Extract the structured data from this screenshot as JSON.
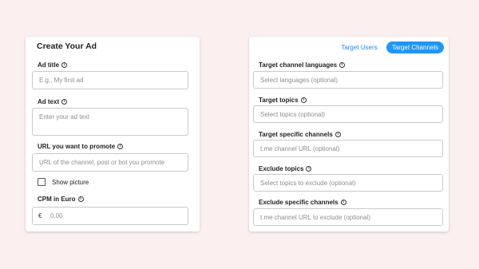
{
  "left": {
    "title": "Create Your Ad",
    "ad_title": {
      "label": "Ad title",
      "placeholder": "E.g., My first ad"
    },
    "ad_text": {
      "label": "Ad text",
      "placeholder": "Enter your ad text"
    },
    "promote_url": {
      "label": "URL you want to promote",
      "placeholder": "URL of the channel, post or bot you promote"
    },
    "show_picture": {
      "label": "Show picture",
      "checked": false
    },
    "cpm": {
      "label": "CPM in Euro",
      "currency": "€",
      "placeholder": "0.00"
    }
  },
  "right": {
    "tabs": [
      {
        "label": "Target Users",
        "active": false
      },
      {
        "label": "Target Channels",
        "active": true
      }
    ],
    "languages": {
      "label": "Target channel languages",
      "placeholder": "Select languages (optional)"
    },
    "topics": {
      "label": "Target topics",
      "placeholder": "Select topics (optional)"
    },
    "channels": {
      "label": "Target specific channels",
      "placeholder": "t.me channel URL (optional)"
    },
    "exclude_topics": {
      "label": "Exclude topics",
      "placeholder": "Select topics to exclude (optional)"
    },
    "exclude_channels": {
      "label": "Exclude specific channels",
      "placeholder": "t.me channel URL to exclude (optional)"
    }
  },
  "colors": {
    "background": "#fcefef",
    "accent": "#2196f3",
    "card": "#ffffff"
  },
  "icons": {
    "info": "info-icon"
  }
}
